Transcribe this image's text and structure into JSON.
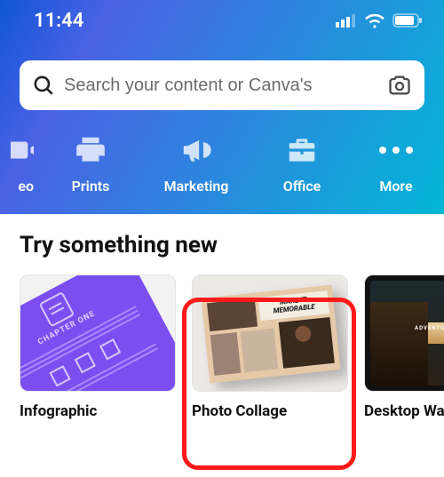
{
  "status": {
    "time": "11:44"
  },
  "search": {
    "placeholder": "Search your content or Canva's"
  },
  "pills": {
    "video_partial": "eo",
    "prints": "Prints",
    "marketing": "Marketing",
    "office": "Office",
    "more": "More"
  },
  "section": {
    "heading": "Try something new",
    "cards": [
      {
        "label": "Infographic",
        "art_top": "CHAPTER ONE"
      },
      {
        "label": "Photo Collage",
        "art_line1": "MAKE IT",
        "art_line2": "MEMORABLE"
      },
      {
        "label": "Desktop Wal",
        "art_text": "ADVENTURE IS W"
      }
    ]
  }
}
